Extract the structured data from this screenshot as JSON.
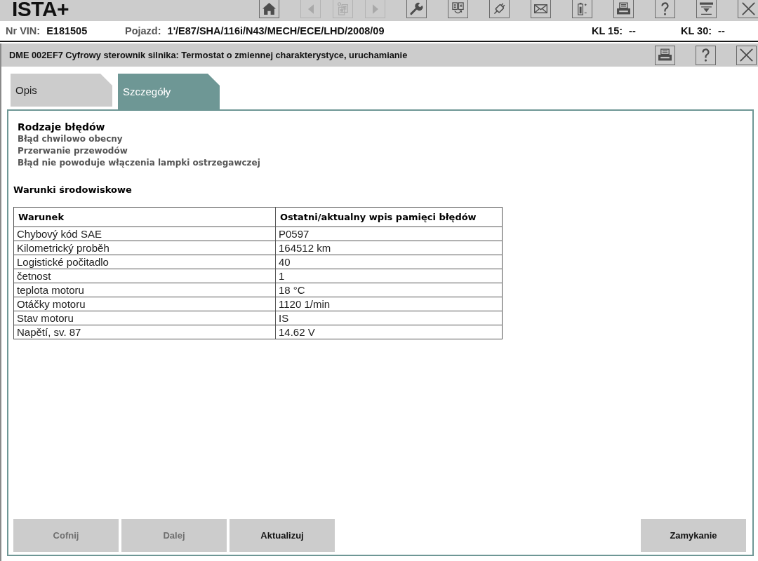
{
  "app": {
    "title": "ISTA+",
    "toolbar": [
      {
        "kind": "home",
        "disabled": false
      },
      {
        "kind": "back",
        "disabled": true
      },
      {
        "kind": "documents",
        "disabled": true
      },
      {
        "kind": "forward",
        "disabled": true
      },
      {
        "kind": "wrench",
        "disabled": false
      },
      {
        "kind": "exchange",
        "disabled": false
      },
      {
        "kind": "plug",
        "disabled": false
      },
      {
        "kind": "mail",
        "disabled": false
      },
      {
        "kind": "battery",
        "disabled": false
      },
      {
        "kind": "print",
        "disabled": false
      },
      {
        "kind": "help",
        "disabled": false
      },
      {
        "kind": "panel",
        "disabled": false
      },
      {
        "kind": "close",
        "disabled": false
      }
    ]
  },
  "vehicle_bar": {
    "fields": [
      {
        "label": "Nr VIN:",
        "value": "E181505"
      },
      {
        "label": "Pojazd:",
        "value": "1'/E87/SHA/116i/N43/MECH/ECE/LHD/2008/09"
      }
    ],
    "terminals": [
      {
        "label": "KL 15:",
        "value": "--"
      },
      {
        "label": "KL 30:",
        "value": "--"
      }
    ]
  },
  "dialog": {
    "title": "DME 002EF7 Cyfrowy sterownik silnika: Termostat o zmiennej charakterystyce, uruchamianie",
    "title_buttons": [
      {
        "kind": "print"
      },
      {
        "kind": "help"
      },
      {
        "kind": "close"
      }
    ],
    "tabs": [
      {
        "label": "Opis",
        "selected": false
      },
      {
        "label": "Szczegóły",
        "selected": true
      }
    ],
    "fault_types": {
      "heading": "Rodzaje błędów",
      "items": [
        "Błąd chwilowo obecny",
        "Przerwanie przewodów",
        "Błąd nie powoduje włączenia lampki ostrzegawczej"
      ]
    },
    "environment": {
      "heading": "Warunki środowiskowe",
      "table": {
        "columns": [
          "Warunek",
          "Ostatni/aktualny wpis pamięci błędów"
        ],
        "rows": [
          [
            "Chybový kód SAE",
            "P0597"
          ],
          [
            "Kilometrický proběh",
            "164512 km"
          ],
          [
            "Logistické počitadlo",
            "40"
          ],
          [
            "četnost",
            "1"
          ],
          [
            "teplota motoru",
            "18 °C"
          ],
          [
            "Otáčky motoru",
            "1120 1/min"
          ],
          [
            "Stav motoru",
            "IS"
          ],
          [
            "Napětí, sv. 87",
            "14.62 V"
          ]
        ]
      }
    },
    "footer": {
      "left_buttons": [
        {
          "label": "Cofnij",
          "disabled": true
        },
        {
          "label": "Dalej",
          "disabled": true
        },
        {
          "label": "Aktualizuj",
          "disabled": false
        }
      ],
      "right_buttons": [
        {
          "label": "Zamykanie",
          "disabled": false
        }
      ]
    }
  }
}
